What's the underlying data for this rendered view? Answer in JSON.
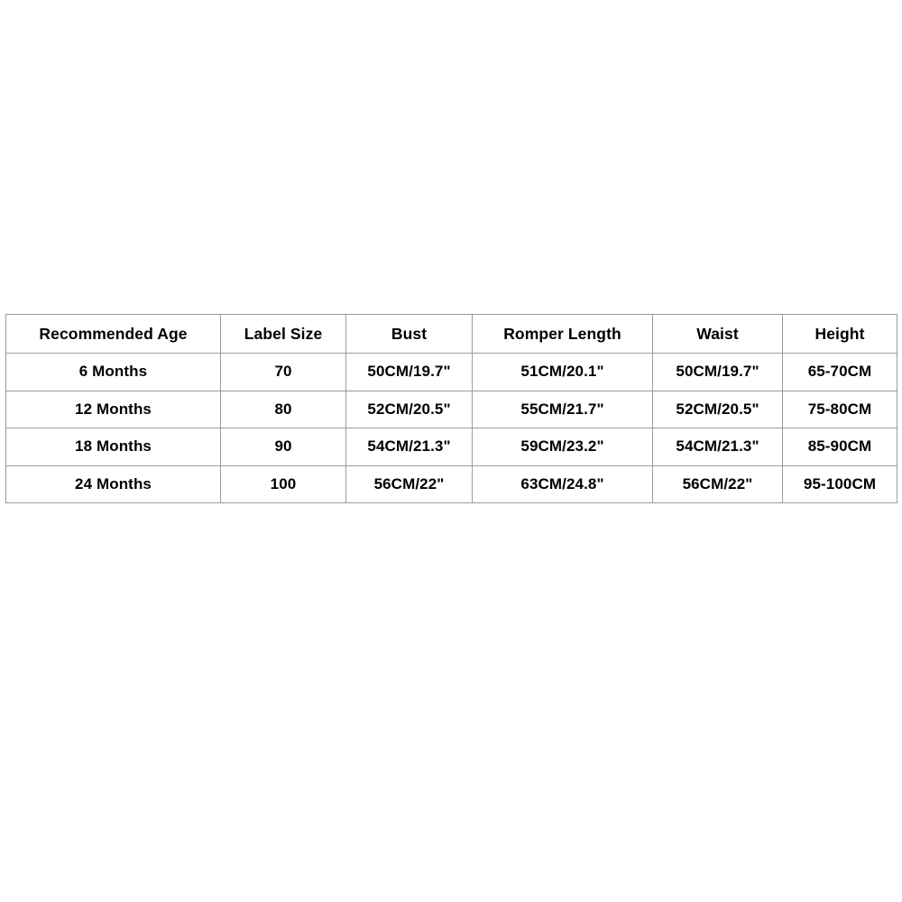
{
  "page": {
    "background_color": "#ffffff",
    "text_color": "#000000",
    "border_color": "#9a9a9a"
  },
  "size_chart": {
    "columns": [
      "Recommended Age",
      "Label Size",
      "Bust",
      "Romper Length",
      "Waist",
      "Height"
    ],
    "rows": [
      {
        "recommended_age": "6 Months",
        "label_size": "70",
        "bust": "50CM/19.7\"",
        "romper_length": "51CM/20.1\"",
        "waist": "50CM/19.7\"",
        "height": "65-70CM"
      },
      {
        "recommended_age": "12 Months",
        "label_size": "80",
        "bust": "52CM/20.5\"",
        "romper_length": "55CM/21.7\"",
        "waist": "52CM/20.5\"",
        "height": "75-80CM"
      },
      {
        "recommended_age": "18 Months",
        "label_size": "90",
        "bust": "54CM/21.3\"",
        "romper_length": "59CM/23.2\"",
        "waist": "54CM/21.3\"",
        "height": "85-90CM"
      },
      {
        "recommended_age": "24 Months",
        "label_size": "100",
        "bust": "56CM/22\"",
        "romper_length": "63CM/24.8\"",
        "waist": "56CM/22\"",
        "height": "95-100CM"
      }
    ]
  }
}
